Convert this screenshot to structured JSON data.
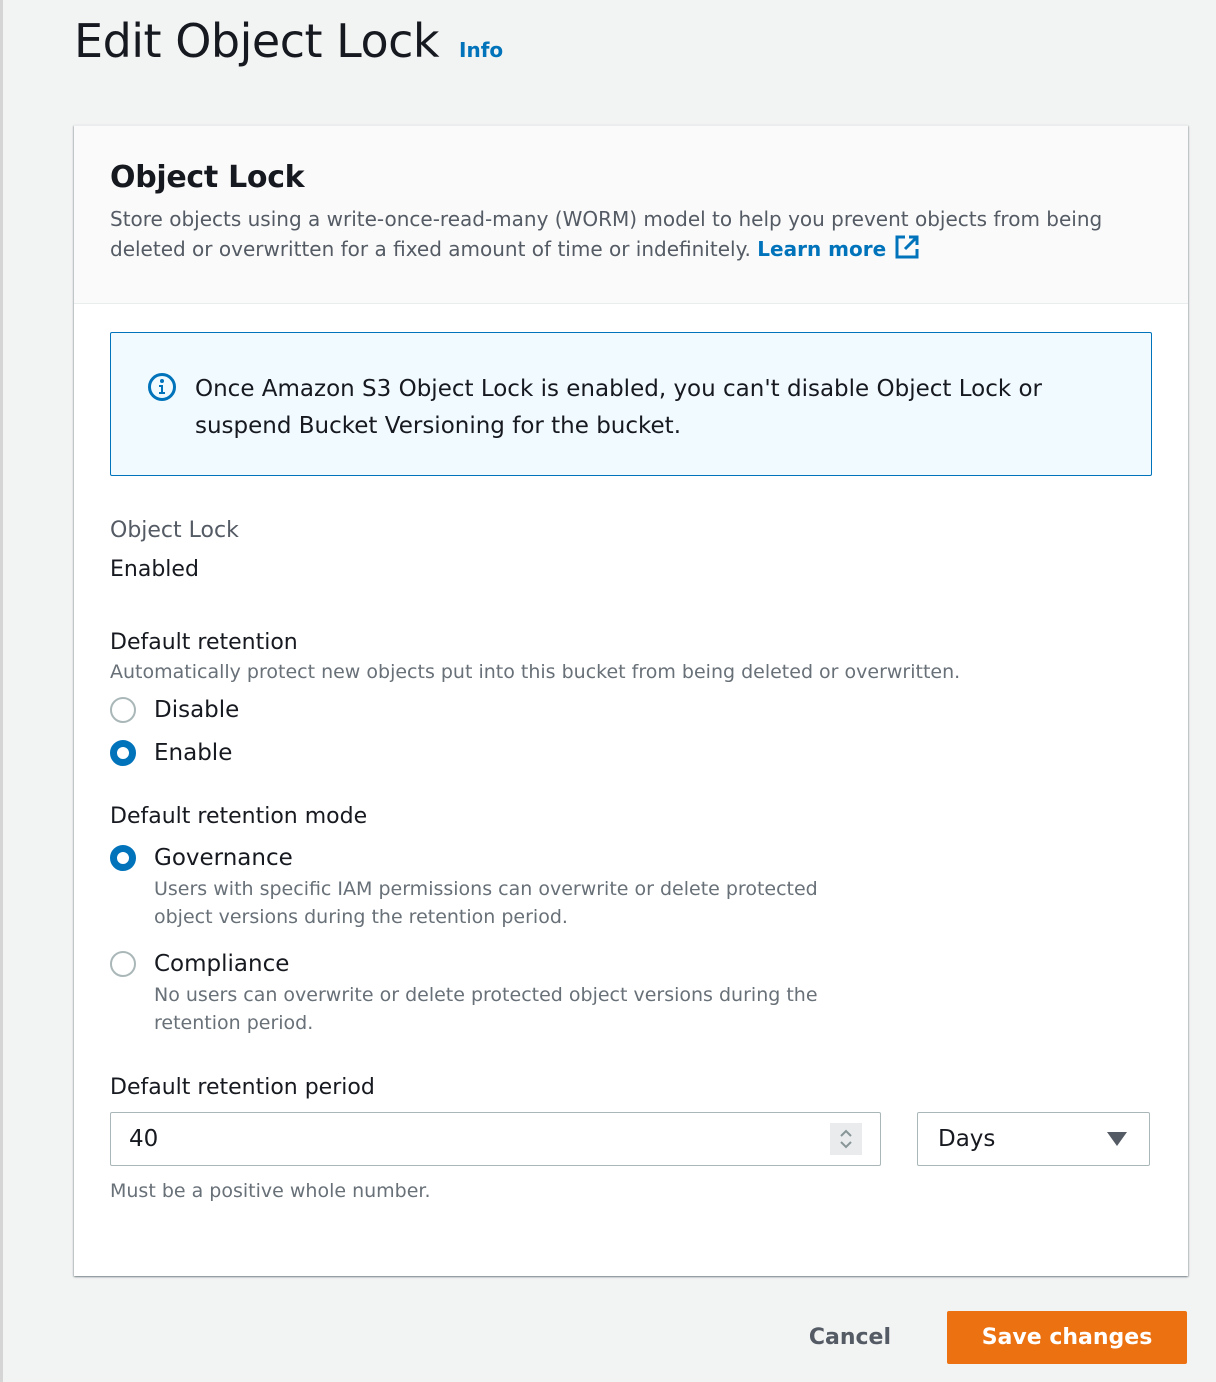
{
  "header": {
    "title": "Edit Object Lock",
    "info_label": "Info"
  },
  "panel": {
    "title": "Object Lock",
    "description": "Store objects using a write-once-read-many (WORM) model to help you prevent objects from being deleted or overwritten for a fixed amount of time or indefinitely.",
    "learn_more_label": "Learn more",
    "learn_more_icon": "external-link-icon"
  },
  "alert": {
    "icon": "info-circle-icon",
    "text": "Once Amazon S3 Object Lock is enabled, you can't disable Object Lock or suspend Bucket Versioning for the bucket."
  },
  "object_lock_status": {
    "label": "Object Lock",
    "value": "Enabled"
  },
  "default_retention": {
    "label": "Default retention",
    "description": "Automatically protect new objects put into this bucket from being deleted or overwritten.",
    "options": [
      {
        "label": "Disable",
        "selected": false
      },
      {
        "label": "Enable",
        "selected": true
      }
    ]
  },
  "retention_mode": {
    "label": "Default retention mode",
    "options": [
      {
        "label": "Governance",
        "description": "Users with specific IAM permissions can overwrite or delete protected object versions during the retention period.",
        "selected": true
      },
      {
        "label": "Compliance",
        "description": "No users can overwrite or delete protected object versions during the retention period.",
        "selected": false
      }
    ]
  },
  "retention_period": {
    "label": "Default retention period",
    "value": "40",
    "unit": "Days",
    "constraint": "Must be a positive whole number."
  },
  "footer": {
    "cancel_label": "Cancel",
    "save_label": "Save changes"
  },
  "colors": {
    "accent": "#0073bb",
    "primary_button": "#ec7211",
    "alert_bg": "#f1faff",
    "page_bg": "#f2f3f3"
  }
}
